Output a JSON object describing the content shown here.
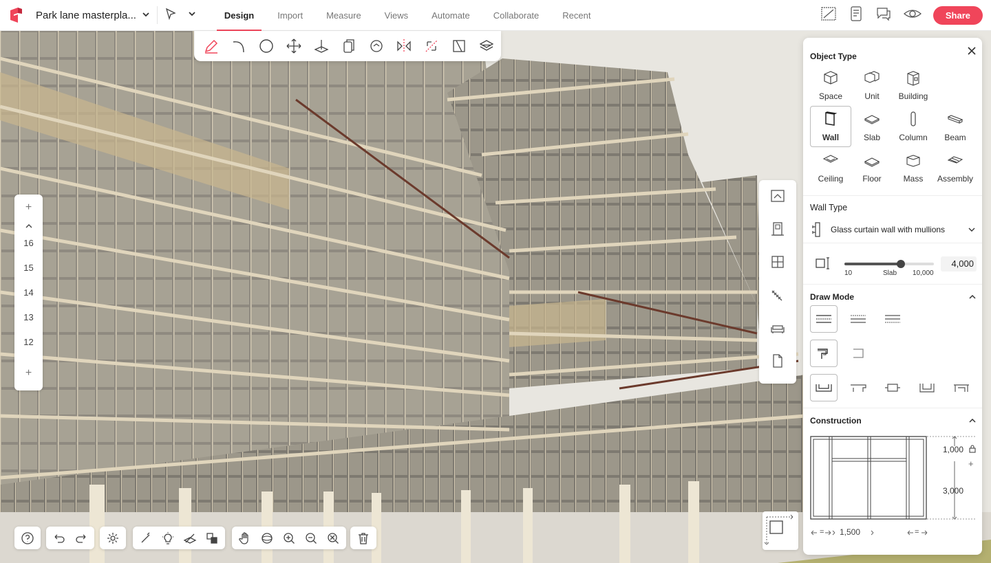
{
  "app": {
    "project_title": "Park lane masterpla...",
    "share_label": "Share"
  },
  "tabs": [
    {
      "label": "Design",
      "active": true
    },
    {
      "label": "Import"
    },
    {
      "label": "Measure"
    },
    {
      "label": "Views"
    },
    {
      "label": "Automate"
    },
    {
      "label": "Collaborate"
    },
    {
      "label": "Recent"
    }
  ],
  "levels": [
    "16",
    "15",
    "14",
    "13",
    "12"
  ],
  "panel": {
    "object_type_title": "Object Type",
    "objects": [
      {
        "label": "Space"
      },
      {
        "label": "Unit"
      },
      {
        "label": "Building"
      },
      {
        "label": "Wall",
        "selected": true
      },
      {
        "label": "Slab"
      },
      {
        "label": "Column"
      },
      {
        "label": "Beam"
      },
      {
        "label": "Ceiling"
      },
      {
        "label": "Floor"
      },
      {
        "label": "Mass"
      },
      {
        "label": "Assembly"
      }
    ],
    "wall_type_title": "Wall Type",
    "wall_type_value": "Glass curtain wall with mullions",
    "height": {
      "value": "4,000",
      "min": "10",
      "mid": "Slab",
      "max": "10,000",
      "level": 0.63
    },
    "draw_mode_title": "Draw Mode",
    "construction_title": "Construction",
    "construction": {
      "top": "1,000",
      "middle": "3,000",
      "width": "1,500",
      "eq_left": "=",
      "eq_right": "="
    }
  },
  "colors": {
    "accent": "#f0455a"
  }
}
